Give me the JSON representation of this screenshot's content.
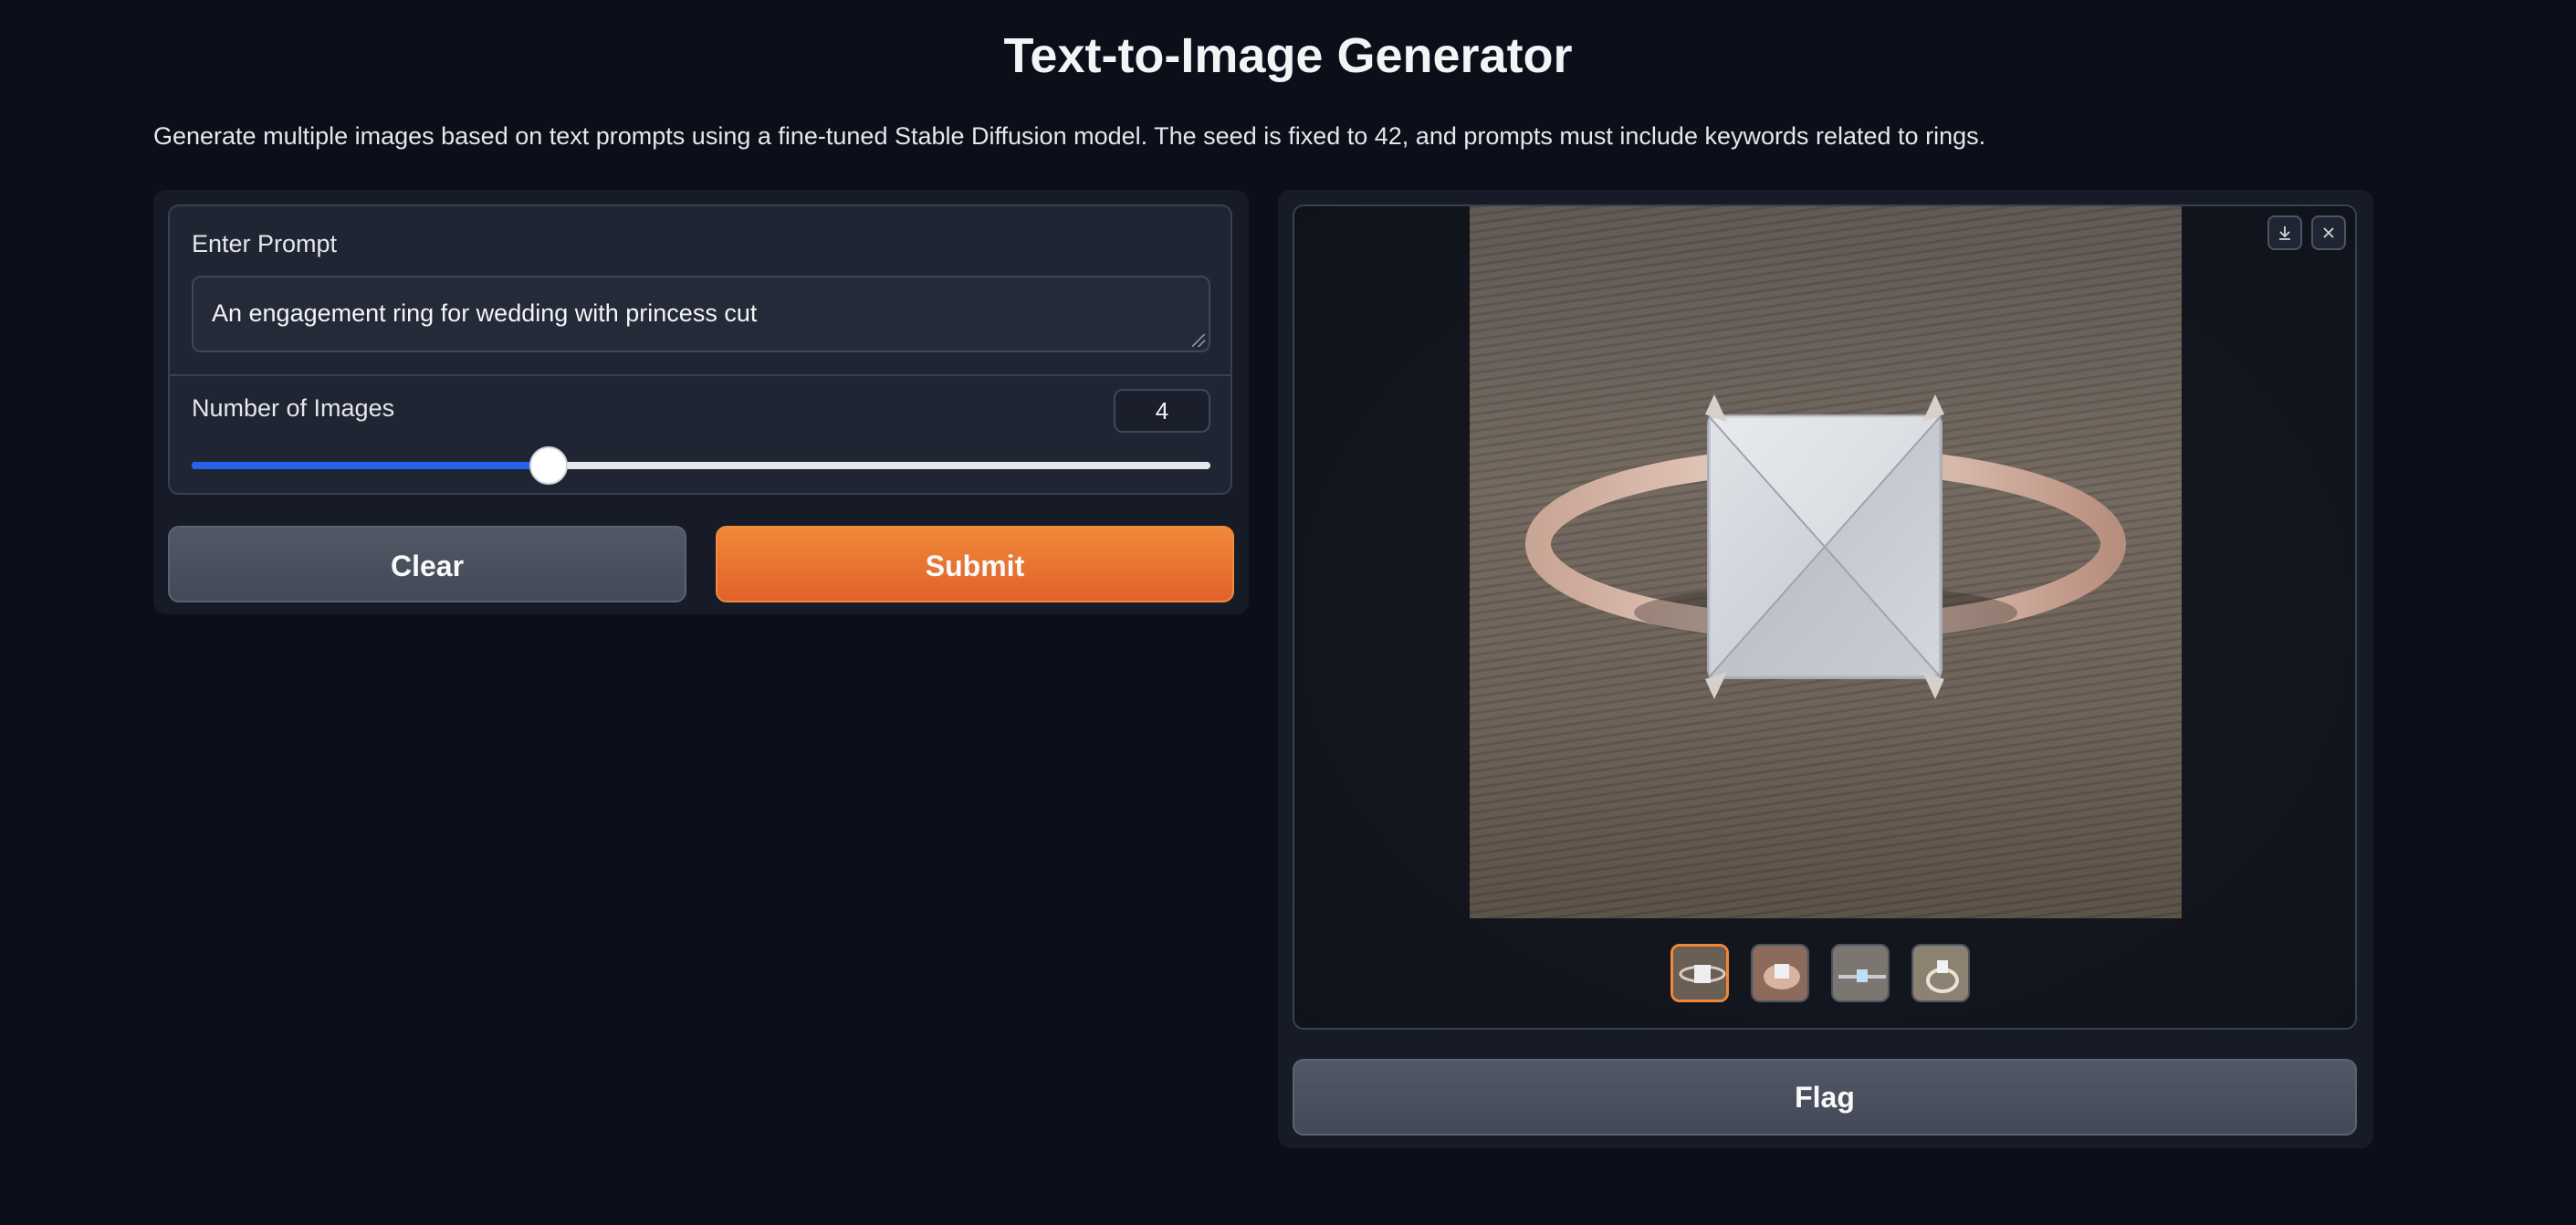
{
  "header": {
    "title": "Text-to-Image Generator",
    "description": "Generate multiple images based on text prompts using a fine-tuned Stable Diffusion model. The seed is fixed to 42, and prompts must include keywords related to rings."
  },
  "inputs": {
    "prompt_label": "Enter Prompt",
    "prompt_value": "An engagement ring for wedding with princess cut",
    "num_images_label": "Number of Images",
    "num_images_value": "4",
    "slider_fraction": 0.35
  },
  "buttons": {
    "clear_label": "Clear",
    "submit_label": "Submit",
    "flag_label": "Flag"
  },
  "gallery": {
    "icons": [
      "download-icon",
      "close-icon"
    ],
    "thumbnail_count": 4,
    "selected_index": 0
  },
  "colors": {
    "background": "#0b0f19",
    "accent_orange": "#f08838",
    "slider_blue": "#2563eb"
  }
}
